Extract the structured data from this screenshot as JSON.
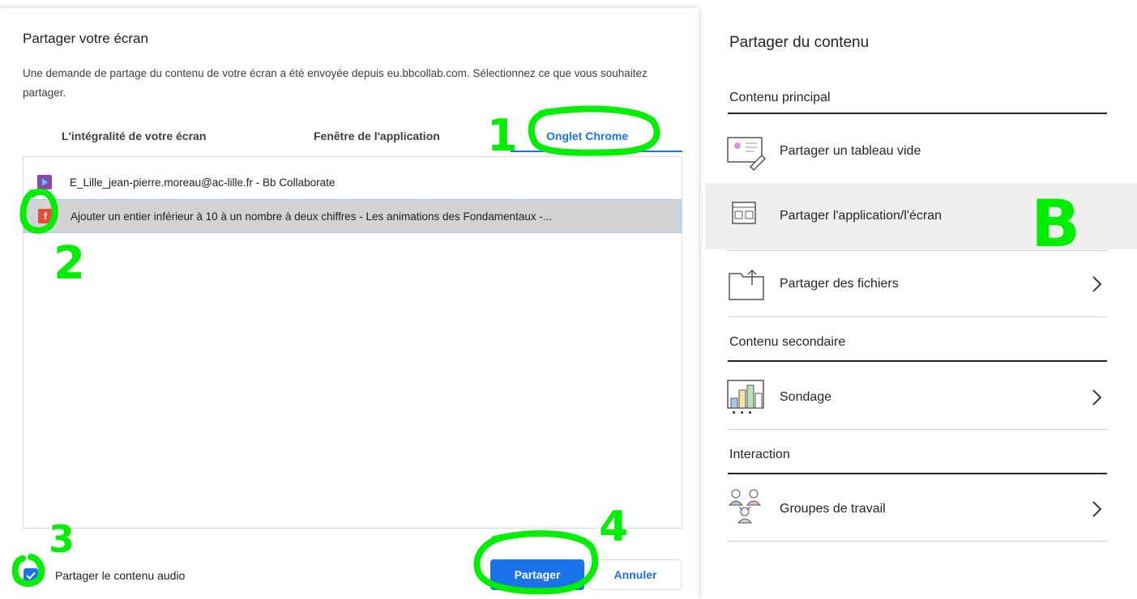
{
  "dialog": {
    "title": "Partager votre écran",
    "description": "Une demande de partage du contenu de votre écran a été envoyée depuis eu.bbcollab.com. Sélectionnez ce que vous souhaitez partager.",
    "tabs": [
      {
        "label": "L'intégralité de votre écran",
        "active": false
      },
      {
        "label": "Fenêtre de l'application",
        "active": false
      },
      {
        "label": "Onglet Chrome",
        "active": true
      }
    ],
    "list": [
      {
        "label": "E_Lille_jean-pierre.moreau@ac-lille.fr - Bb Collaborate",
        "icon": "bb-collaborate-icon",
        "selected": false
      },
      {
        "label": "Ajouter un entier inférieur à 10 à un nombre à deux chiffres - Les animations des Fondamentaux -...",
        "icon": "fondamentaux-icon",
        "icon_glyph": "f",
        "selected": true
      }
    ],
    "audio_checkbox": {
      "label": "Partager le contenu audio",
      "checked": true
    },
    "share_button": "Partager",
    "cancel_button": "Annuler"
  },
  "panel": {
    "title": "Partager du contenu",
    "sections": [
      {
        "label": "Contenu principal",
        "items": [
          {
            "label": "Partager un tableau vide",
            "icon": "whiteboard-icon",
            "chevron": false,
            "highlighted": false
          },
          {
            "label": "Partager l'application/l'écran",
            "icon": "application-screen-icon",
            "chevron": false,
            "highlighted": true
          },
          {
            "label": "Partager des fichiers",
            "icon": "files-folder-icon",
            "chevron": true,
            "highlighted": false
          }
        ]
      },
      {
        "label": "Contenu secondaire",
        "items": [
          {
            "label": "Sondage",
            "icon": "poll-chart-icon",
            "chevron": true,
            "highlighted": false
          }
        ]
      },
      {
        "label": "Interaction",
        "items": [
          {
            "label": "Groupes de travail",
            "icon": "breakout-groups-icon",
            "chevron": true,
            "highlighted": false
          }
        ]
      }
    ]
  },
  "annotations": {
    "color": "#00ee00",
    "step_1": "1",
    "step_2": "2",
    "step_3": "3",
    "step_4": "4",
    "letter_b": "B"
  },
  "colors": {
    "accent": "#1a73e8",
    "selected_row": "#d3d3d3",
    "highlight_item": "#efefef"
  }
}
